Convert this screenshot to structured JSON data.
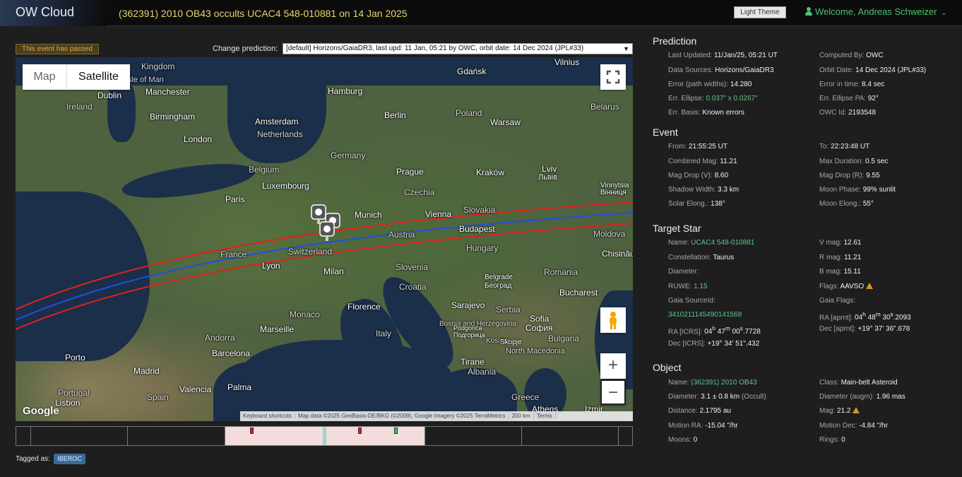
{
  "header": {
    "logo": "OW Cloud",
    "title": "(362391) 2010 OB43 occults UCAC4 548-010881 on 14 Jan 2025",
    "theme_button": "Light Theme",
    "welcome": "Welcome, Andreas Schweizer"
  },
  "status": {
    "passed": "This event has passed"
  },
  "prediction_select": {
    "label": "Change prediction:",
    "value": "[default] Horizons/GaiaDR3, last upd: 11 Jan, 05:21 by OWC, orbit date: 14 Dec 2024 (JPL#33)"
  },
  "map": {
    "type_map": "Map",
    "type_satellite": "Satellite",
    "zoom_in": "+",
    "zoom_out": "−",
    "google": "Google",
    "attribution": [
      "Keyboard shortcuts",
      "Map data ©2025 GeoBasis-DE/BKG (©2009), Google Imagery ©2025 TerraMetrics",
      "200 km",
      "Terms"
    ],
    "cities": [
      "Dublin",
      "Manchester",
      "Birmingham",
      "London",
      "Amsterdam",
      "Hamburg",
      "Berlin",
      "Gdańsk",
      "Warsaw",
      "Vilnius",
      "Paris",
      "Luxembourg",
      "Prague",
      "Kraków",
      "Lviv",
      "Львів",
      "Munich",
      "Vienna",
      "Budapest",
      "Lyon",
      "Milan",
      "Florence",
      "Marseille",
      "Barcelona",
      "Madrid",
      "Porto",
      "Valencia",
      "Lisbon",
      "Palma",
      "Sarajevo",
      "Belgrade",
      "Београд",
      "Bucharest",
      "Sofia",
      "София",
      "Tirane",
      "Skopje",
      "Podgorica",
      "Подгорица",
      "Athens",
      "Izmir",
      "Chisinău",
      "Vinnytsia",
      "Вінниця"
    ],
    "countries": [
      "Kingdom",
      "Isle of Man",
      "Ireland",
      "Netherlands",
      "Germany",
      "Poland",
      "Belarus",
      "Belgium",
      "Czechia",
      "Slovakia",
      "France",
      "Switzerland",
      "Austria",
      "Hungary",
      "Moldova",
      "Slovenia",
      "Croatia",
      "Romania",
      "Monaco",
      "Andorra",
      "Italy",
      "Bosnia and Herzegovina",
      "Serbia",
      "Bulgaria",
      "Kosovo",
      "North Macedonia",
      "Albania",
      "Spain",
      "Portugal",
      "Greece"
    ]
  },
  "footer": {
    "tagged_label": "Tagged as:",
    "tag": "IBEROC"
  },
  "prediction": {
    "title": "Prediction",
    "left": [
      {
        "k": "Last Updated:",
        "v": "11/Jan/25, 05:21 UT"
      },
      {
        "k": "Data Sources:",
        "v": "Horizons/GaiaDR3"
      },
      {
        "k": "Error (path widths):",
        "v": "14.280"
      },
      {
        "k": "Err. Ellipse:",
        "v": "0.037\" x 0.0267\""
      },
      {
        "k": "Err. Basis:",
        "v": "Known errors"
      }
    ],
    "right": [
      {
        "k": "Computed By:",
        "v": "OWC"
      },
      {
        "k": "Orbit Date:",
        "v": "14 Dec 2024 (JPL#33)"
      },
      {
        "k": "Error in time:",
        "v": "8.4 sec"
      },
      {
        "k": "Err. Ellipse PA:",
        "v": "92°"
      },
      {
        "k": "OWC Id:",
        "v": "2193548"
      }
    ]
  },
  "event": {
    "title": "Event",
    "left": [
      {
        "k": "From:",
        "v": "21:55:25 UT"
      },
      {
        "k": "Combined Mag:",
        "v": "11.21"
      },
      {
        "k": "Mag Drop (V):",
        "v": "8.60"
      },
      {
        "k": "Shadow Width:",
        "v": "3.3 km"
      },
      {
        "k": "Solar Elong.:",
        "v": "138°"
      }
    ],
    "right": [
      {
        "k": "To:",
        "v": "22:23:48 UT"
      },
      {
        "k": "Max Duration:",
        "v": "0.5 sec"
      },
      {
        "k": "Mag Drop (R):",
        "v": "9.55"
      },
      {
        "k": "Moon Phase:",
        "v": "99% sunlit"
      },
      {
        "k": "Moon Elong.:",
        "v": "55°"
      }
    ]
  },
  "star": {
    "title": "Target Star",
    "name_k": "Name:",
    "name_v": "UCAC4 548-010881",
    "const_k": "Constellation:",
    "const_v": "Taurus",
    "diam_k": "Diameter:",
    "ruwe_k": "RUWE:",
    "ruwe_v": "1.15",
    "gaia_k": "Gaia SourceId:",
    "gaia_v": "3410211145490141568",
    "ra_k": "RA [ICRS]:",
    "ra_h": "04",
    "ra_m": "47",
    "ra_s": "00",
    "ra_f": ".7728",
    "dec_k": "Dec [ICRS]:",
    "dec_d": "+19°",
    "dec_m": "34",
    "dec_s": "51",
    "dec_f": ".432",
    "vmag_k": "V mag:",
    "vmag_v": "12.61",
    "rmag_k": "R mag:",
    "rmag_v": "11.21",
    "bmag_k": "B mag:",
    "bmag_v": "15.11",
    "flags_k": "Flags:",
    "flags_v": "AAVSO",
    "gflags_k": "Gaia Flags:",
    "raa_k": "RA [aprnt]:",
    "raa_h": "04",
    "raa_m": "48",
    "raa_s": "30",
    "raa_f": ".2093",
    "deca_k": "Dec [aprnt]:",
    "deca_d": "+19°",
    "deca_m": "37",
    "deca_s": "36",
    "deca_f": ".678"
  },
  "object": {
    "title": "Object",
    "left": [
      {
        "k": "Name:",
        "v": "(362391) 2010 OB43",
        "green": true
      },
      {
        "k": "Diameter:",
        "v": "3.1 ± 0.8 km",
        "extra": "(Occult)"
      },
      {
        "k": "Distance:",
        "v": "2.1795 au"
      },
      {
        "k": "Motion RA:",
        "v": "-15.04 \"/hr"
      },
      {
        "k": "Moons:",
        "v": "0"
      }
    ],
    "right": [
      {
        "k": "Class:",
        "v": "Main-belt Asteroid"
      },
      {
        "k": "Diameter (augm):",
        "v": "1.96 mas"
      },
      {
        "k": "Mag:",
        "v": "21.2",
        "warn": true
      },
      {
        "k": "Motion Dec:",
        "v": "-4.84 \"/hr"
      },
      {
        "k": "Rings:",
        "v": "0"
      }
    ]
  },
  "colors": {
    "accent_green": "#5fc48a",
    "title_yellow": "#e6d36a",
    "path_red": "#e02020",
    "path_blue": "#1e50e0"
  }
}
